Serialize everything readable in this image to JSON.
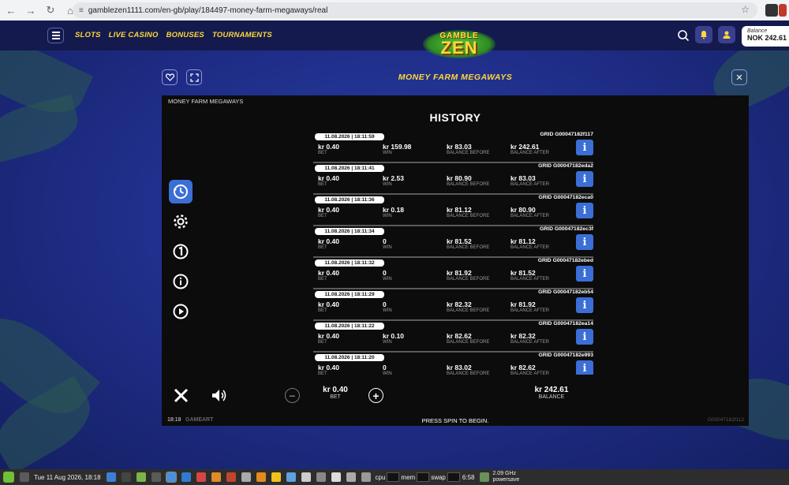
{
  "browser": {
    "url": "gamblezen1111.com/en-gb/play/184497-money-farm-megaways/real"
  },
  "header": {
    "nav": [
      "SLOTS",
      "LIVE CASINO",
      "BONUSES",
      "TOURNAMENTS"
    ],
    "logo_top": "GAMBLE",
    "logo_main": "ZEN",
    "balance_label": "Balance",
    "balance_value": "NOK 242.61"
  },
  "game": {
    "title": "MONEY FARM MEGAWAYS",
    "name_tag": "MONEY FARM MEGAWAYS",
    "history_title": "HISTORY",
    "labels": {
      "bet": "BET",
      "win": "WIN",
      "balance_before": "BALANCE BEFORE",
      "balance_after": "BALANCE AFTER"
    },
    "rows": [
      {
        "time": "11.08.2026 | 18:11:59",
        "grid": "GRID G00047182f117",
        "bet": "kr 0.40",
        "win": "kr 159.98",
        "before": "kr 83.03",
        "after": "kr 242.61"
      },
      {
        "time": "11.08.2026 | 18:11:41",
        "grid": "GRID G00047182eda2",
        "bet": "kr 0.40",
        "win": "kr 2.53",
        "before": "kr 80.90",
        "after": "kr 83.03"
      },
      {
        "time": "11.08.2026 | 18:11:36",
        "grid": "GRID G00047182eca0",
        "bet": "kr 0.40",
        "win": "kr 0.18",
        "before": "kr 81.12",
        "after": "kr 80.90"
      },
      {
        "time": "11.08.2026 | 18:11:34",
        "grid": "GRID G00047182ec3f",
        "bet": "kr 0.40",
        "win": "0",
        "before": "kr 81.52",
        "after": "kr 81.12"
      },
      {
        "time": "11.08.2026 | 18:11:32",
        "grid": "GRID G00047182ebed",
        "bet": "kr 0.40",
        "win": "0",
        "before": "kr 81.92",
        "after": "kr 81.52"
      },
      {
        "time": "11.08.2026 | 18:11:29",
        "grid": "GRID G00047182eb54",
        "bet": "kr 0.40",
        "win": "0",
        "before": "kr 82.32",
        "after": "kr 81.92"
      },
      {
        "time": "11.08.2026 | 18:11:22",
        "grid": "GRID G00047182ea14",
        "bet": "kr 0.40",
        "win": "kr 0.10",
        "before": "kr 82.62",
        "after": "kr 82.32"
      },
      {
        "time": "11.08.2026 | 18:11:20",
        "grid": "GRID G00047182e993",
        "bet": "kr 0.40",
        "win": "0",
        "before": "kr 83.02",
        "after": "kr 82.62"
      }
    ],
    "bottom": {
      "bet_value": "kr 0.40",
      "bet_label": "BET",
      "balance_value": "kr 242.61",
      "balance_label": "BALANCE"
    },
    "footer": {
      "time": "18:18",
      "brand": "GAMEART",
      "message": "PRESS SPIN TO BEGIN.",
      "id": "G00047182f112"
    }
  },
  "taskbar": {
    "datetime": "Tue 11 Aug 2026, 18:18",
    "cpu": "cpu",
    "mem": "mem",
    "swap": "swap",
    "uptime": "6:58",
    "freq": "2.09 GHz",
    "governor": "powersave"
  },
  "colors": {
    "accent_yellow": "#ffd83a",
    "info_blue": "#3b6fd6",
    "header_bg": "#141a4d"
  }
}
